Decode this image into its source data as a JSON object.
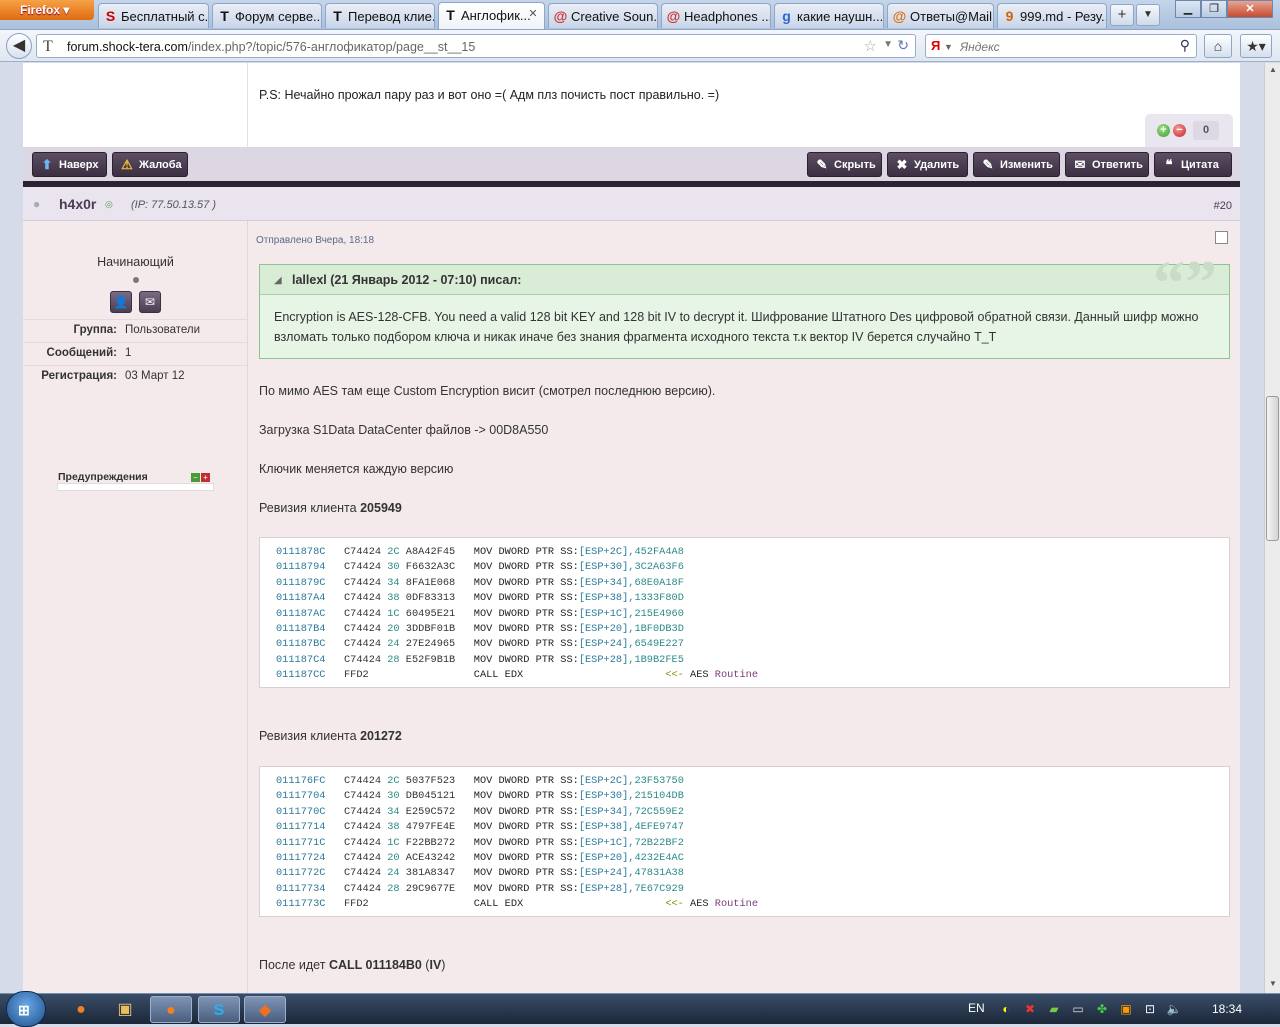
{
  "browser": {
    "menu_button": "Firefox",
    "tabs": [
      {
        "label": "Бесплатный с...",
        "icon": "S",
        "active": false
      },
      {
        "label": "Форум серве...",
        "icon": "T",
        "active": false
      },
      {
        "label": "Перевод клие...",
        "icon": "T",
        "active": false
      },
      {
        "label": "Англофик...",
        "icon": "T",
        "active": true
      },
      {
        "label": "Creative Soun...",
        "icon": "@",
        "active": false
      },
      {
        "label": "Headphones ...",
        "icon": "@",
        "active": false
      },
      {
        "label": "какие наушн...",
        "icon": "g",
        "active": false
      },
      {
        "label": "Ответы@Mail...",
        "icon": "@",
        "active": false
      },
      {
        "label": "999.md - Резу...",
        "icon": "9",
        "active": false
      }
    ],
    "new_tab": "+",
    "url_host": "forum.shock-tera.com",
    "url_path": "/index.php?/topic/576-англофикатор/page__st__15",
    "search_placeholder": "Яндекс",
    "search_engine": "Я"
  },
  "prev_post": {
    "ps_text": "P.S: Нечайно прожал пару раз и вот оно =( Адм плз почисть пост правильно. =)",
    "rep_count": "0",
    "buttons_left": [
      "Наверх",
      "Жалоба"
    ],
    "buttons_right": [
      "Скрыть",
      "Удалить",
      "Изменить",
      "Ответить",
      "Цитата"
    ]
  },
  "post": {
    "username": "h4x0r",
    "ip": "(IP: 77.50.13.57 )",
    "post_number": "#20",
    "sent": "Отправлено Вчера, 18:18",
    "author": {
      "rank": "Начинающий",
      "rows": [
        {
          "key": "Группа:",
          "value": "Пользователи"
        },
        {
          "key": "Сообщений:",
          "value": "1"
        },
        {
          "key": "Регистрация:",
          "value": "03 Март 12"
        }
      ],
      "warnings_label": "Предупреждения"
    },
    "quote": {
      "header": "lallexl (21 Январь 2012 - 07:10) писал:",
      "text": "Encryption is AES-128-CFB. You need a valid 128 bit KEY and 128 bit IV to decrypt it. Шифрование Штатного Des цифровой обратной связи. Данный шифр можно взломать только подбором ключа и никак иначе без знания фрагмента исходного текста т.к вектор IV берется случайно T_T"
    },
    "para1": "По мимо AES там еще Custom Encryption висит (смотрел последнюю версию).",
    "para2": "Загрузка S1Data DataCenter файлов -> 00D8A550",
    "para3": "Ключик меняется каждую версию",
    "rev1_label": "Ревизия клиента",
    "rev1_num": "205949",
    "code1": [
      [
        "0111878C",
        "C74424",
        "2C",
        "A8A42F45",
        "MOV DWORD PTR SS:",
        "[ESP+2C]",
        ",452FA4A8",
        ""
      ],
      [
        "01118794",
        "C74424",
        "30",
        "F6632A3C",
        "MOV DWORD PTR SS:",
        "[ESP+30]",
        ",3C2A63F6",
        ""
      ],
      [
        "0111879C",
        "C74424",
        "34",
        "8FA1E068",
        "MOV DWORD PTR SS:",
        "[ESP+34]",
        ",68E0A18F",
        ""
      ],
      [
        "011187A4",
        "C74424",
        "38",
        "0DF83313",
        "MOV DWORD PTR SS:",
        "[ESP+38]",
        ",1333F80D",
        ""
      ],
      [
        "011187AC",
        "C74424",
        "1C",
        "60495E21",
        "MOV DWORD PTR SS:",
        "[ESP+1C]",
        ",215E4960",
        ""
      ],
      [
        "011187B4",
        "C74424",
        "20",
        "3DDBF01B",
        "MOV DWORD PTR SS:",
        "[ESP+20]",
        ",1BF0DB3D",
        ""
      ],
      [
        "011187BC",
        "C74424",
        "24",
        "27E24965",
        "MOV DWORD PTR SS:",
        "[ESP+24]",
        ",6549E227",
        ""
      ],
      [
        "011187C4",
        "C74424",
        "28",
        "E52F9B1B",
        "MOV DWORD PTR SS:",
        "[ESP+28]",
        ",1B9B2FE5",
        ""
      ],
      [
        "011187CC",
        "FFD2",
        "",
        "",
        "CALL EDX",
        "",
        "",
        "<<- AES Routine"
      ]
    ],
    "rev2_label": "Ревизия клиента",
    "rev2_num": "201272",
    "code2": [
      [
        "011176FC",
        "C74424",
        "2C",
        "5037F523",
        "MOV DWORD PTR SS:",
        "[ESP+2C]",
        ",23F53750",
        ""
      ],
      [
        "01117704",
        "C74424",
        "30",
        "DB045121",
        "MOV DWORD PTR SS:",
        "[ESP+30]",
        ",215104DB",
        ""
      ],
      [
        "0111770C",
        "C74424",
        "34",
        "E259C572",
        "MOV DWORD PTR SS:",
        "[ESP+34]",
        ",72C559E2",
        ""
      ],
      [
        "01117714",
        "C74424",
        "38",
        "4797FE4E",
        "MOV DWORD PTR SS:",
        "[ESP+38]",
        ",4EFE9747",
        ""
      ],
      [
        "0111771C",
        "C74424",
        "1C",
        "F22BB272",
        "MOV DWORD PTR SS:",
        "[ESP+1C]",
        ",72B22BF2",
        ""
      ],
      [
        "01117724",
        "C74424",
        "20",
        "ACE43242",
        "MOV DWORD PTR SS:",
        "[ESP+20]",
        ",4232E4AC",
        ""
      ],
      [
        "0111772C",
        "C74424",
        "24",
        "381A8347",
        "MOV DWORD PTR SS:",
        "[ESP+24]",
        ",47831A38",
        ""
      ],
      [
        "01117734",
        "C74424",
        "28",
        "29C9677E",
        "MOV DWORD PTR SS:",
        "[ESP+28]",
        ",7E67C929",
        ""
      ],
      [
        "0111773C",
        "FFD2",
        "",
        "",
        "CALL EDX",
        "",
        "",
        "<<- AES Routine"
      ]
    ],
    "last_prefix": "После идет",
    "last_bold": "CALL 011184B0",
    "last_paren_open": " (",
    "last_iv": "IV",
    "last_paren_close": ")"
  },
  "taskbar": {
    "lang": "EN",
    "clock": "18:34"
  },
  "colors": {
    "post_bg": "#f5eaeb",
    "button_dark": "#3b2f41",
    "quote_bg": "#e6f5e6",
    "accent_link": "#4b3c52"
  }
}
